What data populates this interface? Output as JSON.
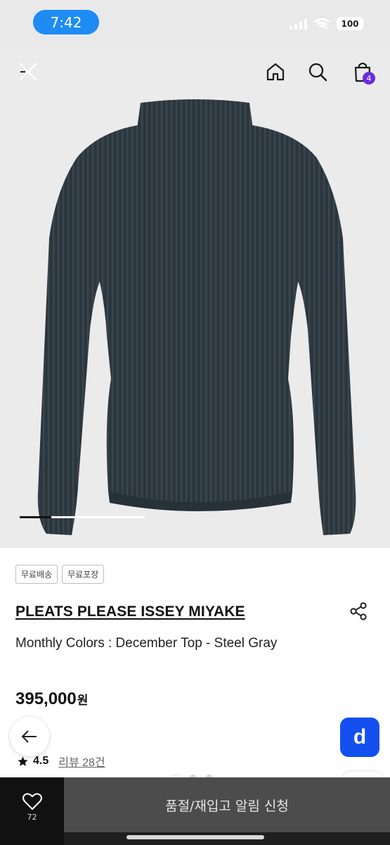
{
  "status_bar": {
    "time": "7:42",
    "battery": "100",
    "icons": [
      "signal-icon",
      "wifi-icon",
      "battery-icon"
    ]
  },
  "header": {
    "cart_count": "4",
    "icons": [
      "close-icon",
      "home-icon",
      "search-icon",
      "shopping-bag-icon"
    ]
  },
  "product_image": {
    "description_alt": "",
    "carousel_progress": 0.25
  },
  "tags": [
    "무료배송",
    "무료포장"
  ],
  "product": {
    "brand": "PLEATS PLEASE ISSEY MIYAKE",
    "name": "Monthly Colors : December Top - Steel Gray",
    "price": "395,000",
    "price_unit": "원",
    "rating": "4.5",
    "review_label": "리뷰 28건"
  },
  "floating": {
    "d_label": "d"
  },
  "page_dots": {
    "count": 3,
    "active_index": 0
  },
  "bottom_bar": {
    "like_count": "72",
    "restock_label": "품절/재입고 알림 신청"
  },
  "colors": {
    "accent_badge": "#6b2be0",
    "time_pill": "#1e8cf4",
    "d_button": "#1450f0",
    "garment": "#2f3a42"
  }
}
